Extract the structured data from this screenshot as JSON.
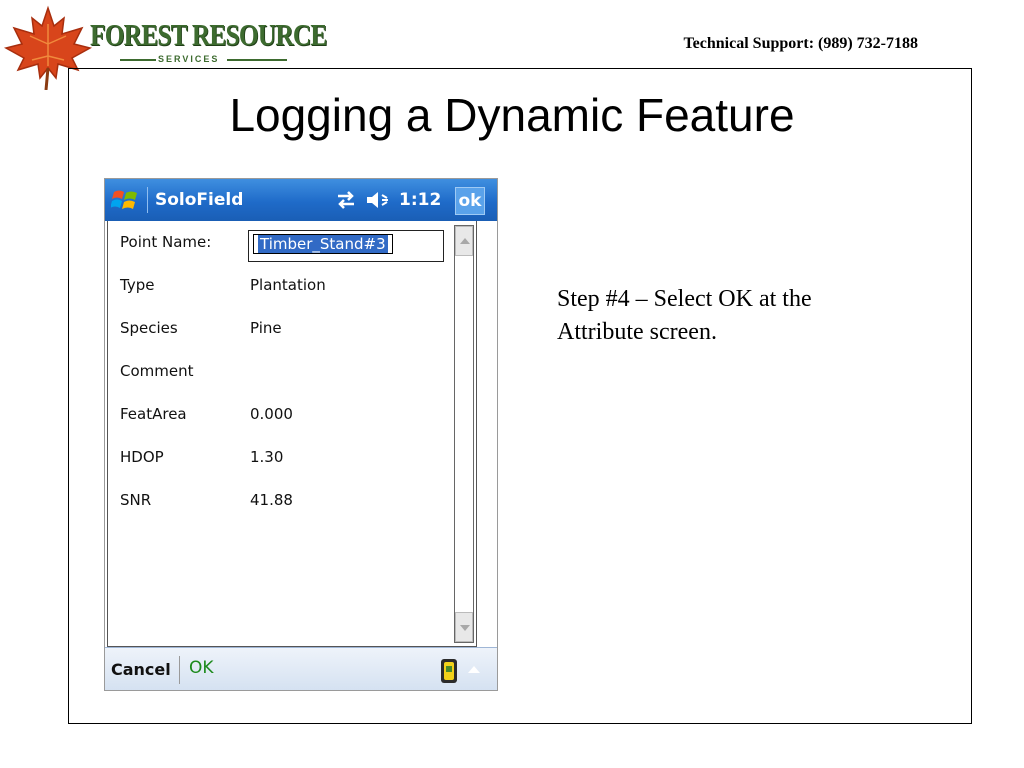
{
  "header": {
    "logo_title": "FOREST RESOURCE",
    "logo_subtitle": "SERVICES",
    "support": "Technical Support: (989) 732-7188"
  },
  "slide": {
    "title": "Logging a Dynamic Feature",
    "step_text": "Step #4 – Select OK at the Attribute screen."
  },
  "device": {
    "app_name": "SoloField",
    "time": "1:12",
    "ok_label": "ok",
    "title_bar_color": "#1f6bc9",
    "fields": [
      {
        "label": "Point Name:",
        "value": "Timber_Stand#3"
      },
      {
        "label": "Type",
        "value": "Plantation"
      },
      {
        "label": "Species",
        "value": "Pine"
      },
      {
        "label": "Comment",
        "value": ""
      },
      {
        "label": "FeatArea",
        "value": "0.000"
      },
      {
        "label": "HDOP",
        "value": "1.30"
      },
      {
        "label": "SNR",
        "value": "41.88"
      }
    ],
    "bottom": {
      "cancel_label": "Cancel",
      "ok_label": "OK"
    },
    "icons": [
      "windows-start-icon",
      "connectivity-icon",
      "volume-icon",
      "input-panel-icon",
      "chevron-up-icon"
    ]
  }
}
